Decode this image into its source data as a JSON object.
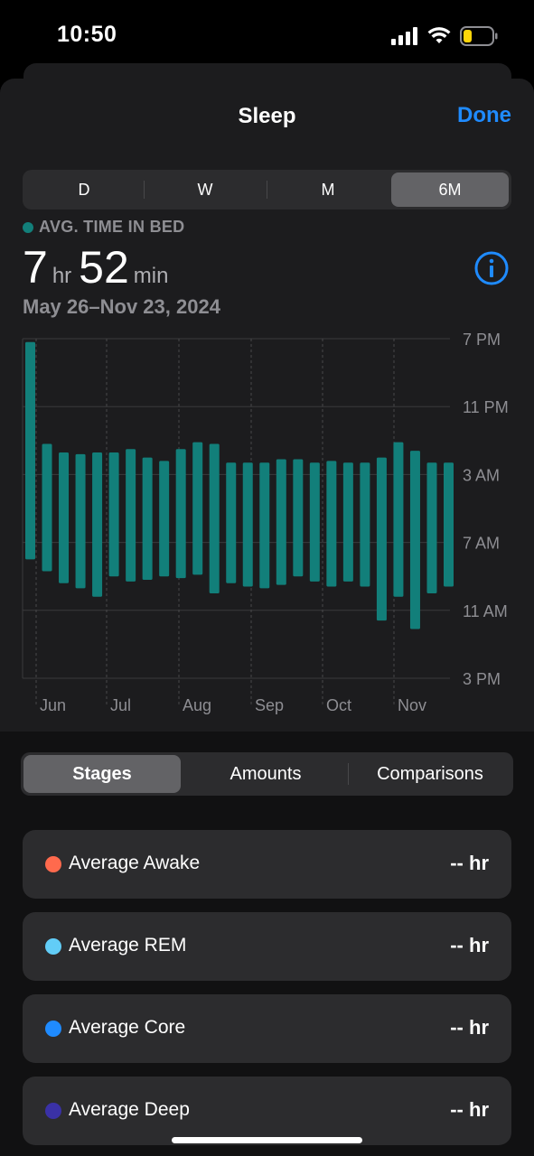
{
  "status": {
    "time": "10:50"
  },
  "nav": {
    "title": "Sleep",
    "done_label": "Done"
  },
  "period_tabs": [
    "D",
    "W",
    "M",
    "6M"
  ],
  "period_selected": "6M",
  "summary": {
    "legend_label": "AVG. TIME IN BED",
    "hours": "7",
    "hours_unit": "hr",
    "minutes": "52",
    "minutes_unit": "min",
    "date_range": "May 26–Nov 23, 2024"
  },
  "colors": {
    "accent": "#1f8bff",
    "in_bed": "#127f7a",
    "awake": "#ff6a4d",
    "rem": "#62cdf7",
    "core": "#1f8bff",
    "deep": "#3a31a6"
  },
  "chart_data": {
    "type": "bar",
    "y_axis_labels": [
      "7 PM",
      "11 PM",
      "3 AM",
      "7 AM",
      "11 AM",
      "3 PM"
    ],
    "y_range_hours_from_7pm": [
      0,
      20
    ],
    "x_axis_labels": [
      "Jun",
      "Jul",
      "Aug",
      "Sep",
      "Oct",
      "Nov"
    ],
    "series": [
      {
        "values": [
          {
            "start": 0.2,
            "end": 13.0
          },
          {
            "start": 6.2,
            "end": 13.7
          },
          {
            "start": 6.7,
            "end": 14.4
          },
          {
            "start": 6.8,
            "end": 14.7
          },
          {
            "start": 6.7,
            "end": 15.2
          },
          {
            "start": 6.7,
            "end": 14.0
          },
          {
            "start": 6.5,
            "end": 14.3
          },
          {
            "start": 7.0,
            "end": 14.2
          },
          {
            "start": 7.2,
            "end": 14.0
          },
          {
            "start": 6.5,
            "end": 14.1
          },
          {
            "start": 6.1,
            "end": 13.9
          },
          {
            "start": 6.2,
            "end": 15.0
          },
          {
            "start": 7.3,
            "end": 14.4
          },
          {
            "start": 7.3,
            "end": 14.6
          },
          {
            "start": 7.3,
            "end": 14.7
          },
          {
            "start": 7.1,
            "end": 14.5
          },
          {
            "start": 7.1,
            "end": 14.0
          },
          {
            "start": 7.3,
            "end": 14.3
          },
          {
            "start": 7.2,
            "end": 14.6
          },
          {
            "start": 7.3,
            "end": 14.3
          },
          {
            "start": 7.3,
            "end": 14.6
          },
          {
            "start": 7.0,
            "end": 16.6
          },
          {
            "start": 6.1,
            "end": 15.2
          },
          {
            "start": 6.6,
            "end": 17.1
          },
          {
            "start": 7.3,
            "end": 15.0
          },
          {
            "start": 7.3,
            "end": 14.6
          }
        ]
      }
    ]
  },
  "view_tabs": [
    "Stages",
    "Amounts",
    "Comparisons"
  ],
  "view_selected": "Stages",
  "stages": [
    {
      "label": "Average Awake",
      "value": "-- hr",
      "color": "#ff6a4d"
    },
    {
      "label": "Average REM",
      "value": "-- hr",
      "color": "#62cdf7"
    },
    {
      "label": "Average Core",
      "value": "-- hr",
      "color": "#1f8bff"
    },
    {
      "label": "Average Deep",
      "value": "-- hr",
      "color": "#3a31a6"
    }
  ]
}
